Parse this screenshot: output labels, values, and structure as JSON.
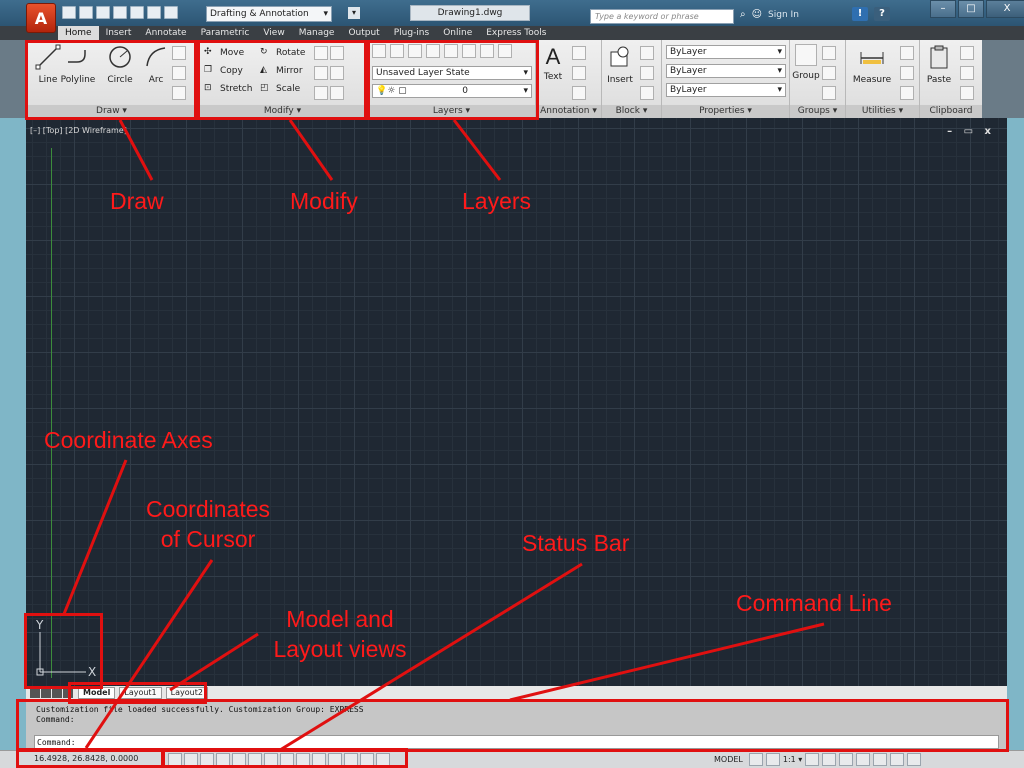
{
  "titlebar": {
    "app_letter": "A",
    "workspace": "Drafting & Annotation",
    "doc_title": "Drawing1.dwg",
    "search_placeholder": "Type a keyword or phrase",
    "signin": "Sign In",
    "minimize": "–",
    "restore": "□",
    "close": "X"
  },
  "tabs": [
    "Home",
    "Insert",
    "Annotate",
    "Parametric",
    "View",
    "Manage",
    "Output",
    "Plug-ins",
    "Online",
    "Express Tools"
  ],
  "ribbon": {
    "draw": {
      "label": "Draw ▾",
      "tools": [
        "Line",
        "Polyline",
        "Circle",
        "Arc"
      ]
    },
    "modify": {
      "label": "Modify ▾",
      "rows": [
        "Move",
        "Rotate",
        "Copy",
        "Mirror",
        "Stretch",
        "Scale"
      ]
    },
    "layers": {
      "label": "Layers ▾",
      "state": "Unsaved Layer State",
      "current": "0"
    },
    "annotation": {
      "label": "Annotation ▾",
      "text": "Text"
    },
    "block": {
      "label": "Block ▾",
      "insert": "Insert"
    },
    "properties": {
      "label": "Properties ▾",
      "color": "ByLayer",
      "linetype": "ByLayer",
      "lineweight": "ByLayer"
    },
    "groups": {
      "label": "Groups ▾",
      "group": "Group"
    },
    "utilities": {
      "label": "Utilities ▾",
      "measure": "Measure"
    },
    "clipboard": {
      "label": "Clipboard",
      "paste": "Paste"
    }
  },
  "viewport": {
    "label": "[–] [Top] [2D Wireframe]",
    "ctrls": "– ▭ x",
    "ucs_y": "Y",
    "ucs_x": "X"
  },
  "layout_tabs": [
    "Model",
    "Layout1",
    "Layout2"
  ],
  "command": {
    "line1": "Customization file loaded successfully. Customization Group: EXPRESS",
    "line2": "Command:",
    "prompt": "Command:"
  },
  "status": {
    "coords": "16.4928, 26.8428, 0.0000",
    "model": "MODEL",
    "scale": "1:1 ▾"
  },
  "annotations": {
    "draw": "Draw",
    "modify": "Modify",
    "layers": "Layers",
    "coordinate_axes": "Coordinate Axes",
    "coordinates_line1": "Coordinates",
    "coordinates_line2": "of Cursor",
    "model_layout_line1": "Model and",
    "model_layout_line2": "Layout views",
    "status_bar": "Status Bar",
    "command_line": "Command Line"
  },
  "colors": {
    "annotation": "#e01010",
    "canvas": "#1f2833",
    "app_button": "#c8320f"
  }
}
